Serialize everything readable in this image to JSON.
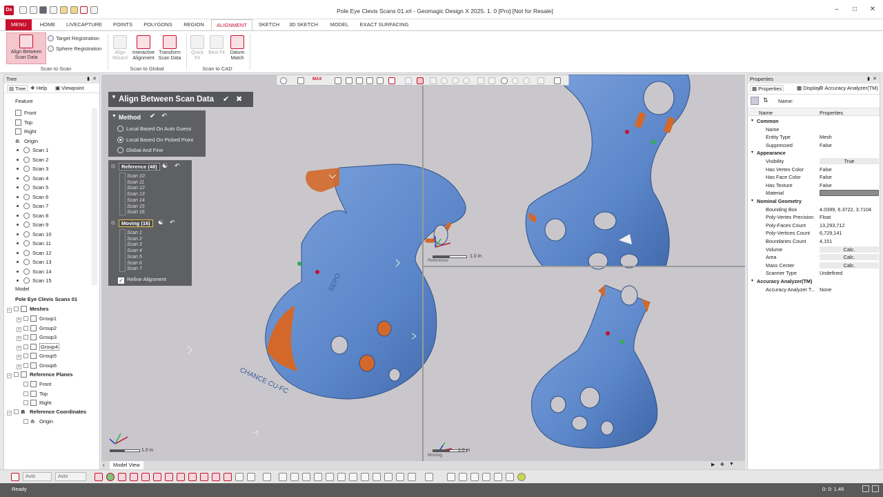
{
  "window": {
    "title": "Pole Eye Clevis Scans 01.xrl - Geomagic Design X 2025. 1. 0 [Pro] [Not for Resale]",
    "logo_text": "Dx",
    "minimize": "–",
    "maximize": "□",
    "close": "✕"
  },
  "menu_tabs": [
    "MENU",
    "HOME",
    "LIVECAPTURE",
    "POINTS",
    "POLYGONS",
    "REGION",
    "ALIGNMENT",
    "SKETCH",
    "3D SKETCH",
    "MODEL",
    "EXACT SURFACING"
  ],
  "ribbon": {
    "align_between": "Align Between Scan Data",
    "target_registration": "Target Registration",
    "sphere_registration": "Sphere Registration",
    "group1_label": "Scan to Scan",
    "align_wizard": "Align Wizard",
    "interactive_alignment": "Interactive Alignment",
    "transform_scan_data": "Transform Scan Data",
    "group2_label": "Scan to Global",
    "quick_fit": "Quick Fit",
    "best_fit": "Best Fit",
    "datum_match": "Datum Match",
    "group3_label": "Scan to CAD"
  },
  "left_panel": {
    "title": "Tree",
    "tabs": [
      "Tree",
      "Help",
      "Viewpoint"
    ],
    "feature_header": "Feature",
    "planes": [
      "Front",
      "Top",
      "Right"
    ],
    "origin": "Origin",
    "scans": [
      "Scan 1",
      "Scan 2",
      "Scan 3",
      "Scan 4",
      "Scan 5",
      "Scan 6",
      "Scan 7",
      "Scan 8",
      "Scan 9",
      "Scan 10",
      "Scan 11",
      "Scan 12",
      "Scan 13",
      "Scan 14",
      "Scan 15"
    ],
    "model_header": "Model",
    "model_root": "Pole Eye Clevis Scans 01",
    "meshes": "Meshes",
    "groups": [
      "Group1",
      "Group2",
      "Group3",
      "Group4",
      "Group5",
      "Group6"
    ],
    "ref_planes": "Reference Planes",
    "ref_plane_items": [
      "Front",
      "Top",
      "Right"
    ],
    "ref_coords": "Reference Coordinates",
    "ref_coord_origin": "Origin"
  },
  "dialog": {
    "title": "Align Between Scan Data",
    "method_title": "Method",
    "methods": [
      "Local Based On Auto Guess",
      "Local Based On Picked Point",
      "Global And Fine"
    ],
    "selected_method": 1,
    "reference_label": "Reference (48)",
    "reference_scans": [
      "Scan 10",
      "Scan 11",
      "Scan 12",
      "Scan 13",
      "Scan 14",
      "Scan 15",
      "Scan 16"
    ],
    "moving_label": "Moving (16)",
    "moving_scans": [
      "Scan 1",
      "Scan 2",
      "Scan 3",
      "Scan 4",
      "Scan 5",
      "Scan 6",
      "Scan 7"
    ],
    "refine_alignment": "Refine Alignment"
  },
  "viewport": {
    "scale_main": "1.0 in",
    "scale_ref": "1.0 in",
    "scale_moving": "1.0 in",
    "ref_label": "Reference",
    "moving_label": "Moving",
    "part_text_left": "CHANCE CU-FC",
    "part_text_right": "SEPO"
  },
  "properties": {
    "title": "Properties",
    "tabs": [
      "Properties",
      "Display",
      "Accuracy Analyzer(TM)"
    ],
    "name_label": "Name:",
    "col_name": "Name",
    "col_props": "Properties",
    "rows": [
      {
        "type": "cat",
        "k": "Common"
      },
      {
        "k": "Name",
        "v": ""
      },
      {
        "k": "Entity Type",
        "v": "Mesh"
      },
      {
        "k": "Suppressed",
        "v": "False"
      },
      {
        "type": "cat",
        "k": "Appearance"
      },
      {
        "k": "Visibility",
        "v": "True",
        "btn": true
      },
      {
        "k": "Has Vertex Color",
        "v": "False"
      },
      {
        "k": "Has Face Color",
        "v": "False"
      },
      {
        "k": "Has Texture",
        "v": "False"
      },
      {
        "k": "Material",
        "v": "",
        "swatch": true
      },
      {
        "type": "cat",
        "k": "Nominal Geometry"
      },
      {
        "k": "Bounding Box",
        "v": "4.0399, 6.3722, 3.7104"
      },
      {
        "k": "Poly-Vertex Precision",
        "v": "Float"
      },
      {
        "k": "Poly-Faces Count",
        "v": "13,293,712"
      },
      {
        "k": "Poly-Vertices Count",
        "v": "6,729,141"
      },
      {
        "k": "Boundaries Count",
        "v": "4,151"
      },
      {
        "k": "Volume",
        "v": "Calc.",
        "btn": true
      },
      {
        "k": "Area",
        "v": "Calc.",
        "btn": true
      },
      {
        "k": "Mass Center",
        "v": "Calc.",
        "btn": true
      },
      {
        "k": "Scanner Type",
        "v": "Undefined"
      },
      {
        "type": "cat",
        "k": "Accuracy Analyzer(TM)"
      },
      {
        "k": "Accuracy Analyzer T...",
        "v": "None"
      }
    ]
  },
  "bottom": {
    "tab_model_view": "Model View",
    "select1": "Auto",
    "select2": "Auto"
  },
  "status": {
    "text": "Ready",
    "time": "0: 0: 1.46"
  },
  "colors": {
    "accent": "#c8102e",
    "mesh_blue": "#5b86c9",
    "mesh_orange": "#d2692a",
    "viewport_bg": "#c9c7cc",
    "dialog_bg": "#5f6064"
  }
}
